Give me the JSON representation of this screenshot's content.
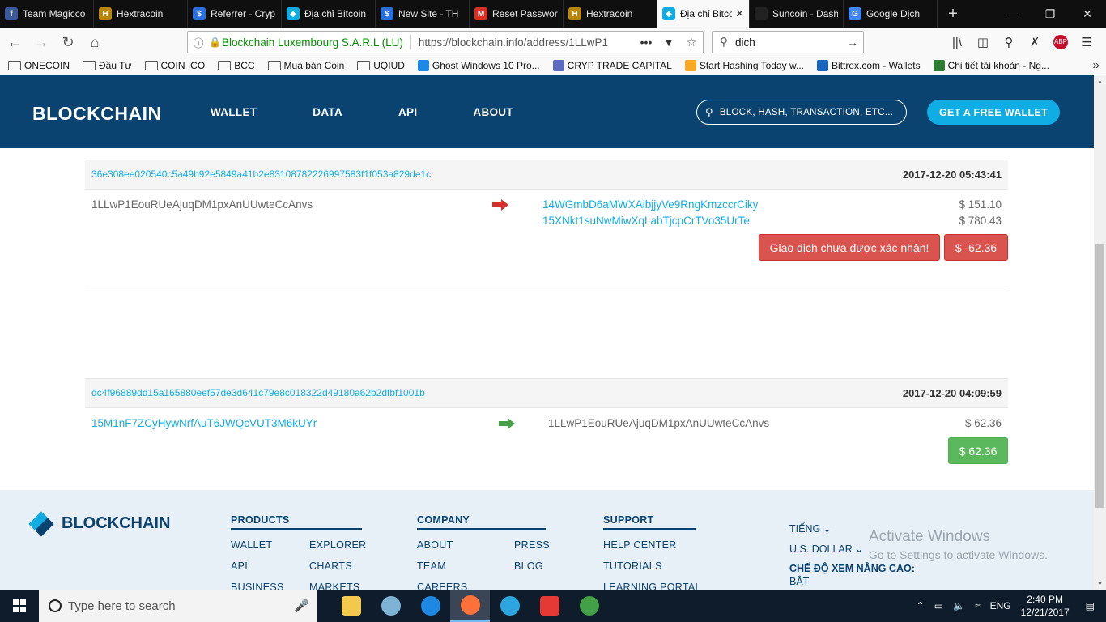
{
  "browser": {
    "tabs": [
      {
        "label": "Team Magicco",
        "icon": "facebook-icon",
        "color": "#3b5998",
        "glyph": "f"
      },
      {
        "label": "Hextracoin",
        "icon": "coin-icon",
        "color": "#b8860b",
        "glyph": "H"
      },
      {
        "label": "Referrer - Cryp",
        "icon": "dollar-coin-icon",
        "color": "#2a6fdb",
        "glyph": "$"
      },
      {
        "label": "Địa chỉ Bitcoin",
        "icon": "blockchain-icon",
        "color": "#10ade4",
        "glyph": "◆"
      },
      {
        "label": "New Site - TH",
        "icon": "dollar-coin-icon",
        "color": "#2a6fdb",
        "glyph": "$"
      },
      {
        "label": "Reset Password",
        "icon": "gmail-icon",
        "color": "#d93025",
        "glyph": "M"
      },
      {
        "label": "Hextracoin",
        "icon": "coin-icon",
        "color": "#b8860b",
        "glyph": "H"
      },
      {
        "label": "Địa chỉ Bitco",
        "icon": "blockchain-icon",
        "color": "#10ade4",
        "glyph": "◆",
        "active": true
      },
      {
        "label": "Suncoin - Dashbo",
        "icon": "sun-icon",
        "color": "#222222",
        "glyph": ""
      },
      {
        "label": "Google Dịch",
        "icon": "translate-icon",
        "color": "#4285f4",
        "glyph": "G"
      }
    ],
    "url_identity": "Blockchain Luxembourg S.A.R.L (LU)",
    "url": "https://blockchain.info/address/1LLwP1",
    "search_value": "dich",
    "bookmarks": [
      {
        "label": "ONECOIN",
        "type": "folder"
      },
      {
        "label": "Đầu Tư",
        "type": "folder"
      },
      {
        "label": "COIN ICO",
        "type": "folder"
      },
      {
        "label": "BCC",
        "type": "folder"
      },
      {
        "label": "Mua bán Coin",
        "type": "folder"
      },
      {
        "label": "UQIUD",
        "type": "folder"
      },
      {
        "label": "Ghost Windows 10 Pro...",
        "type": "site",
        "color": "#1e88e5"
      },
      {
        "label": "CRYP TRADE CAPITAL",
        "type": "site",
        "color": "#5c6bc0"
      },
      {
        "label": "Start Hashing Today w...",
        "type": "site",
        "color": "#f9a825"
      },
      {
        "label": "Bittrex.com - Wallets",
        "type": "site",
        "color": "#1565c0"
      },
      {
        "label": "Chi tiết tài khoản - Ng...",
        "type": "site",
        "color": "#2e7d32"
      }
    ]
  },
  "site": {
    "logo": "BLOCKCHAIN",
    "nav": [
      "WALLET",
      "DATA",
      "API",
      "ABOUT"
    ],
    "search_placeholder": "BLOCK, HASH, TRANSACTION, ETC...",
    "cta": "GET A FREE WALLET"
  },
  "transactions": [
    {
      "hash": "36e308ee020540c5a49b92e5849a41b2e83108782226997583f1f053a829de1c",
      "date": "2017-12-20 05:43:41",
      "from": "1LLwP1EouRUeAjuqDM1pxAnUUwteCcAnvs",
      "arrow_color": "#d32f2f",
      "outputs": [
        {
          "address": "14WGmbD6aMWXAibjjyVe9RngKmzccrCiky",
          "amount": "$ 151.10"
        },
        {
          "address": "15XNkt1suNwMiwXqLabTjcpCrTVo35UrTe",
          "amount": "$ 780.43"
        }
      ],
      "status": "Giao dịch chưa được xác nhận!",
      "net": "$ -62.36"
    },
    {
      "hash": "dc4f96889dd15a165880eef57de3d641c79e8c018322d49180a62b2dfbf1001b",
      "date": "2017-12-20 04:09:59",
      "from": "15M1nF7ZCyHywNrfAuT6JWQcVUT3M6kUYr",
      "arrow_color": "#43a047",
      "outputs": [
        {
          "address": "1LLwP1EouRUeAjuqDM1pxAnUUwteCcAnvs",
          "amount": "$ 62.36"
        }
      ],
      "net": "$ 62.36"
    }
  ],
  "footer": {
    "logo": "BLOCKCHAIN",
    "products": {
      "title": "PRODUCTS",
      "links": [
        "WALLET",
        "EXPLORER",
        "API",
        "CHARTS",
        "BUSINESS",
        "MARKETS"
      ]
    },
    "company": {
      "title": "COMPANY",
      "links": [
        "ABOUT",
        "PRESS",
        "TEAM",
        "BLOG",
        "CAREERS",
        ""
      ]
    },
    "support": {
      "title": "SUPPORT",
      "links": [
        "HELP CENTER",
        "TUTORIALS",
        "LEARNING PORTAL"
      ]
    },
    "language": "TIẾNG",
    "currency": "U.S. DOLLAR",
    "advanced_label": "CHẾ ĐỘ XEM NÂNG CAO:",
    "advanced_value": "BẬT",
    "activate_title": "Activate Windows",
    "activate_sub": "Go to Settings to activate Windows."
  },
  "taskbar": {
    "search_placeholder": "Type here to search",
    "lang": "ENG",
    "time": "2:40 PM",
    "date": "12/21/2017"
  }
}
